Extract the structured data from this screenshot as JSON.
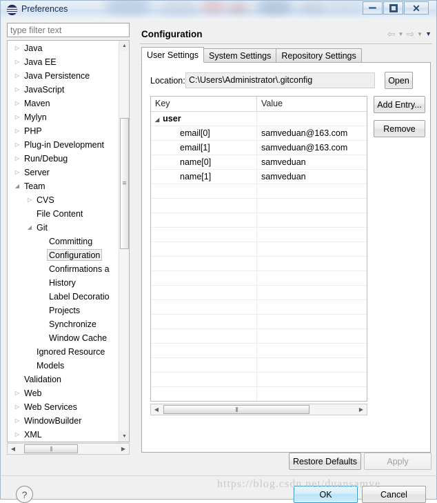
{
  "window": {
    "title": "Preferences",
    "icon": "eclipse-globe-icon",
    "controls": {
      "minimize": "minimize-icon",
      "restore": "restore-icon",
      "close": "close-icon"
    }
  },
  "sidebar": {
    "filter_placeholder": "type filter text",
    "filter_value": "",
    "items": [
      {
        "label": "Java",
        "indent": 0,
        "arrow": "collapsed"
      },
      {
        "label": "Java EE",
        "indent": 0,
        "arrow": "collapsed"
      },
      {
        "label": "Java Persistence",
        "indent": 0,
        "arrow": "collapsed"
      },
      {
        "label": "JavaScript",
        "indent": 0,
        "arrow": "collapsed"
      },
      {
        "label": "Maven",
        "indent": 0,
        "arrow": "collapsed"
      },
      {
        "label": "Mylyn",
        "indent": 0,
        "arrow": "collapsed"
      },
      {
        "label": "PHP",
        "indent": 0,
        "arrow": "collapsed"
      },
      {
        "label": "Plug-in Development",
        "indent": 0,
        "arrow": "collapsed"
      },
      {
        "label": "Run/Debug",
        "indent": 0,
        "arrow": "collapsed"
      },
      {
        "label": "Server",
        "indent": 0,
        "arrow": "collapsed"
      },
      {
        "label": "Team",
        "indent": 0,
        "arrow": "expanded"
      },
      {
        "label": "CVS",
        "indent": 1,
        "arrow": "collapsed"
      },
      {
        "label": "File Content",
        "indent": 1,
        "arrow": "none"
      },
      {
        "label": "Git",
        "indent": 1,
        "arrow": "expanded"
      },
      {
        "label": "Committing",
        "indent": 2,
        "arrow": "none"
      },
      {
        "label": "Configuration",
        "indent": 2,
        "arrow": "none",
        "selected": true
      },
      {
        "label": "Confirmations a",
        "indent": 2,
        "arrow": "none"
      },
      {
        "label": "History",
        "indent": 2,
        "arrow": "none"
      },
      {
        "label": "Label Decoratio",
        "indent": 2,
        "arrow": "none"
      },
      {
        "label": "Projects",
        "indent": 2,
        "arrow": "none"
      },
      {
        "label": "Synchronize",
        "indent": 2,
        "arrow": "none"
      },
      {
        "label": "Window Cache",
        "indent": 2,
        "arrow": "none"
      },
      {
        "label": "Ignored Resource",
        "indent": 1,
        "arrow": "none"
      },
      {
        "label": "Models",
        "indent": 1,
        "arrow": "none"
      },
      {
        "label": "Validation",
        "indent": 0,
        "arrow": "none"
      },
      {
        "label": "Web",
        "indent": 0,
        "arrow": "collapsed"
      },
      {
        "label": "Web Services",
        "indent": 0,
        "arrow": "collapsed"
      },
      {
        "label": "WindowBuilder",
        "indent": 0,
        "arrow": "collapsed"
      },
      {
        "label": "XML",
        "indent": 0,
        "arrow": "collapsed"
      }
    ]
  },
  "page": {
    "title": "Configuration",
    "nav": {
      "back": "back-arrow-icon",
      "back_menu": "chevron-down-icon",
      "forward": "forward-arrow-icon",
      "forward_menu": "chevron-down-icon",
      "view_menu": "chevron-down-icon"
    },
    "tabs": [
      {
        "label": "User Settings",
        "active": true
      },
      {
        "label": "System Settings",
        "active": false
      },
      {
        "label": "Repository Settings",
        "active": false
      }
    ],
    "location": {
      "label": "Location:",
      "value": "C:\\Users\\Administrator\\.gitconfig",
      "open_button": "Open"
    },
    "table": {
      "columns": [
        "Key",
        "Value"
      ],
      "rows": [
        {
          "key": "user",
          "value": "",
          "type": "group"
        },
        {
          "key": "email[0]",
          "value": "samveduan@163.com",
          "type": "child"
        },
        {
          "key": "email[1]",
          "value": "samveduan@163.com",
          "type": "child"
        },
        {
          "key": "name[0]",
          "value": "samveduan",
          "type": "child"
        },
        {
          "key": "name[1]",
          "value": "samveduan",
          "type": "child"
        }
      ],
      "empty_row_count": 17
    },
    "side_buttons": {
      "add_entry": "Add Entry...",
      "remove": "Remove"
    }
  },
  "footer": {
    "restore_defaults": "Restore Defaults",
    "apply": "Apply",
    "apply_disabled": true,
    "help": "?",
    "ok": "OK",
    "cancel": "Cancel"
  },
  "watermark": "https://blog.csdn.net/duansamve"
}
